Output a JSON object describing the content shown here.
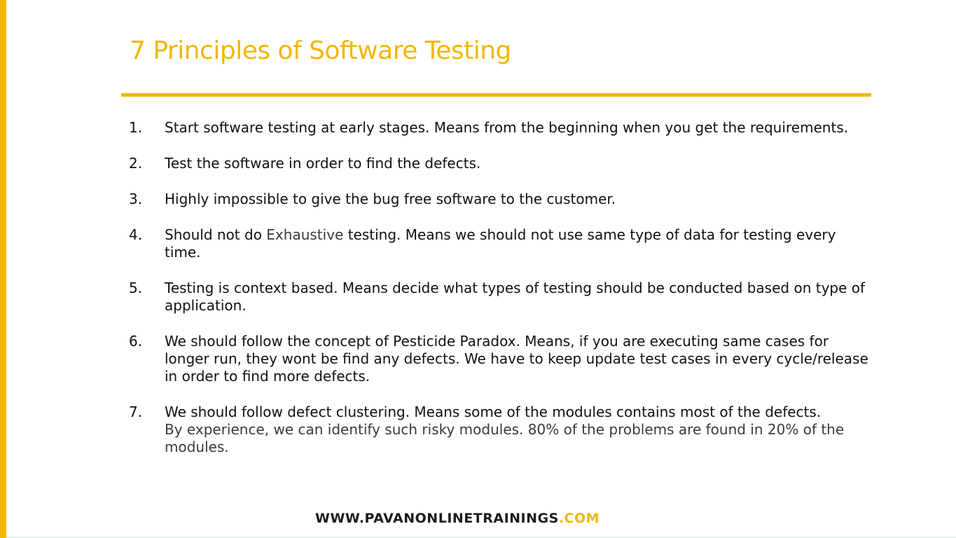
{
  "slide": {
    "title": "7 Principles of Software Testing",
    "principles": [
      {
        "number": "1.",
        "text": "Start software testing at early stages. Means from the beginning when you get the requirements."
      },
      {
        "number": "2.",
        "text": "Test the software in order to find the defects."
      },
      {
        "number": "3.",
        "text": "Highly impossible to give the bug free software to the customer."
      },
      {
        "number": "4.",
        "text_before": "Should not do ",
        "highlight": "Exhaustive",
        "text_after": " testing. Means we should not use same type of data for testing every time."
      },
      {
        "number": "5.",
        "text": "Testing is context based. Means decide what types of testing should be conducted based on type of application."
      },
      {
        "number": "6.",
        "text": "We should follow the concept of  Pesticide Paradox. Means, if you  are executing same cases for longer run, they wont be find any defects. We have to  keep update test cases in every cycle/release in order to find more defects."
      },
      {
        "number": "7.",
        "text": "We should follow defect clustering. Means some of the modules contains most of the defects.",
        "text_extra": "By experience, we can identify such risky modules. 80% of the problems are found in 20% of the modules."
      }
    ],
    "footer": {
      "site": "WWW.PAVANONLINETRAININGS",
      "tld": ".COM"
    },
    "colors": {
      "accent": "#f2b705",
      "text": "#111111",
      "footer_text": "#1c1c1c"
    }
  }
}
